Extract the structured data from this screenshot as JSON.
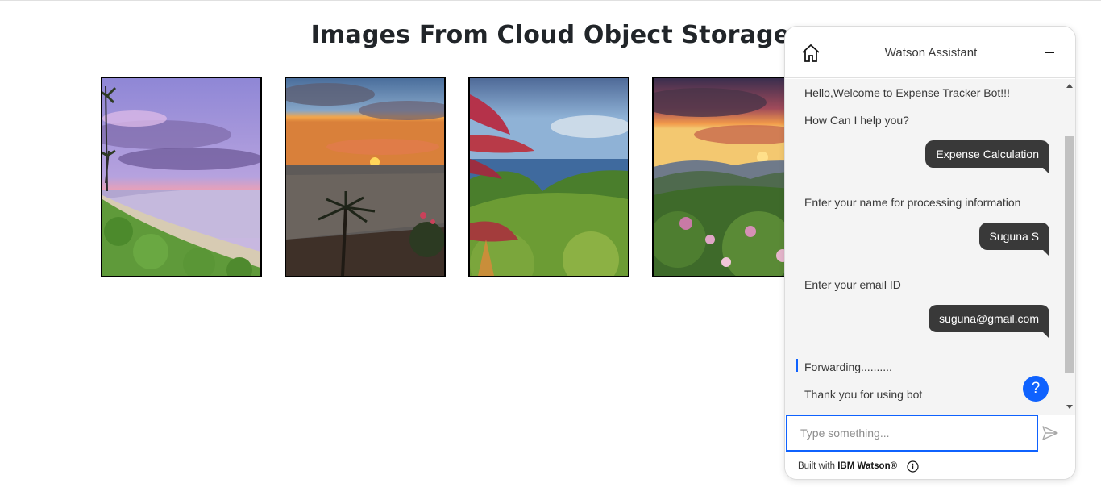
{
  "page": {
    "title": "Images From Cloud Object Storage"
  },
  "gallery": {
    "images": [
      {
        "name": "beach-sunset-photo"
      },
      {
        "name": "palm-sunset-photo"
      },
      {
        "name": "valley-ocean-photo"
      },
      {
        "name": "mountain-sunset-photo"
      }
    ]
  },
  "assistant": {
    "title": "Watson Assistant",
    "home_icon": "home-icon",
    "minimize_icon": "minimize-icon",
    "messages": {
      "welcome": "Hello,Welcome to Expense Tracker Bot!!!",
      "help_prompt": "How Can I help you?",
      "user_choice": "Expense Calculation",
      "ask_name": "Enter your name for processing information",
      "user_name": "Suguna S",
      "ask_email": "Enter your email ID",
      "user_email": "suguna@gmail.com",
      "forwarding": "Forwarding..........",
      "thanks": "Thank you for using bot"
    },
    "input": {
      "placeholder": "Type something..."
    },
    "help_label": "?",
    "footer": {
      "prefix": "Built with ",
      "brand": "IBM Watson®"
    },
    "colors": {
      "accent": "#0f62fe",
      "user_bubble": "#393939",
      "messages_bg": "#f4f4f4"
    }
  }
}
